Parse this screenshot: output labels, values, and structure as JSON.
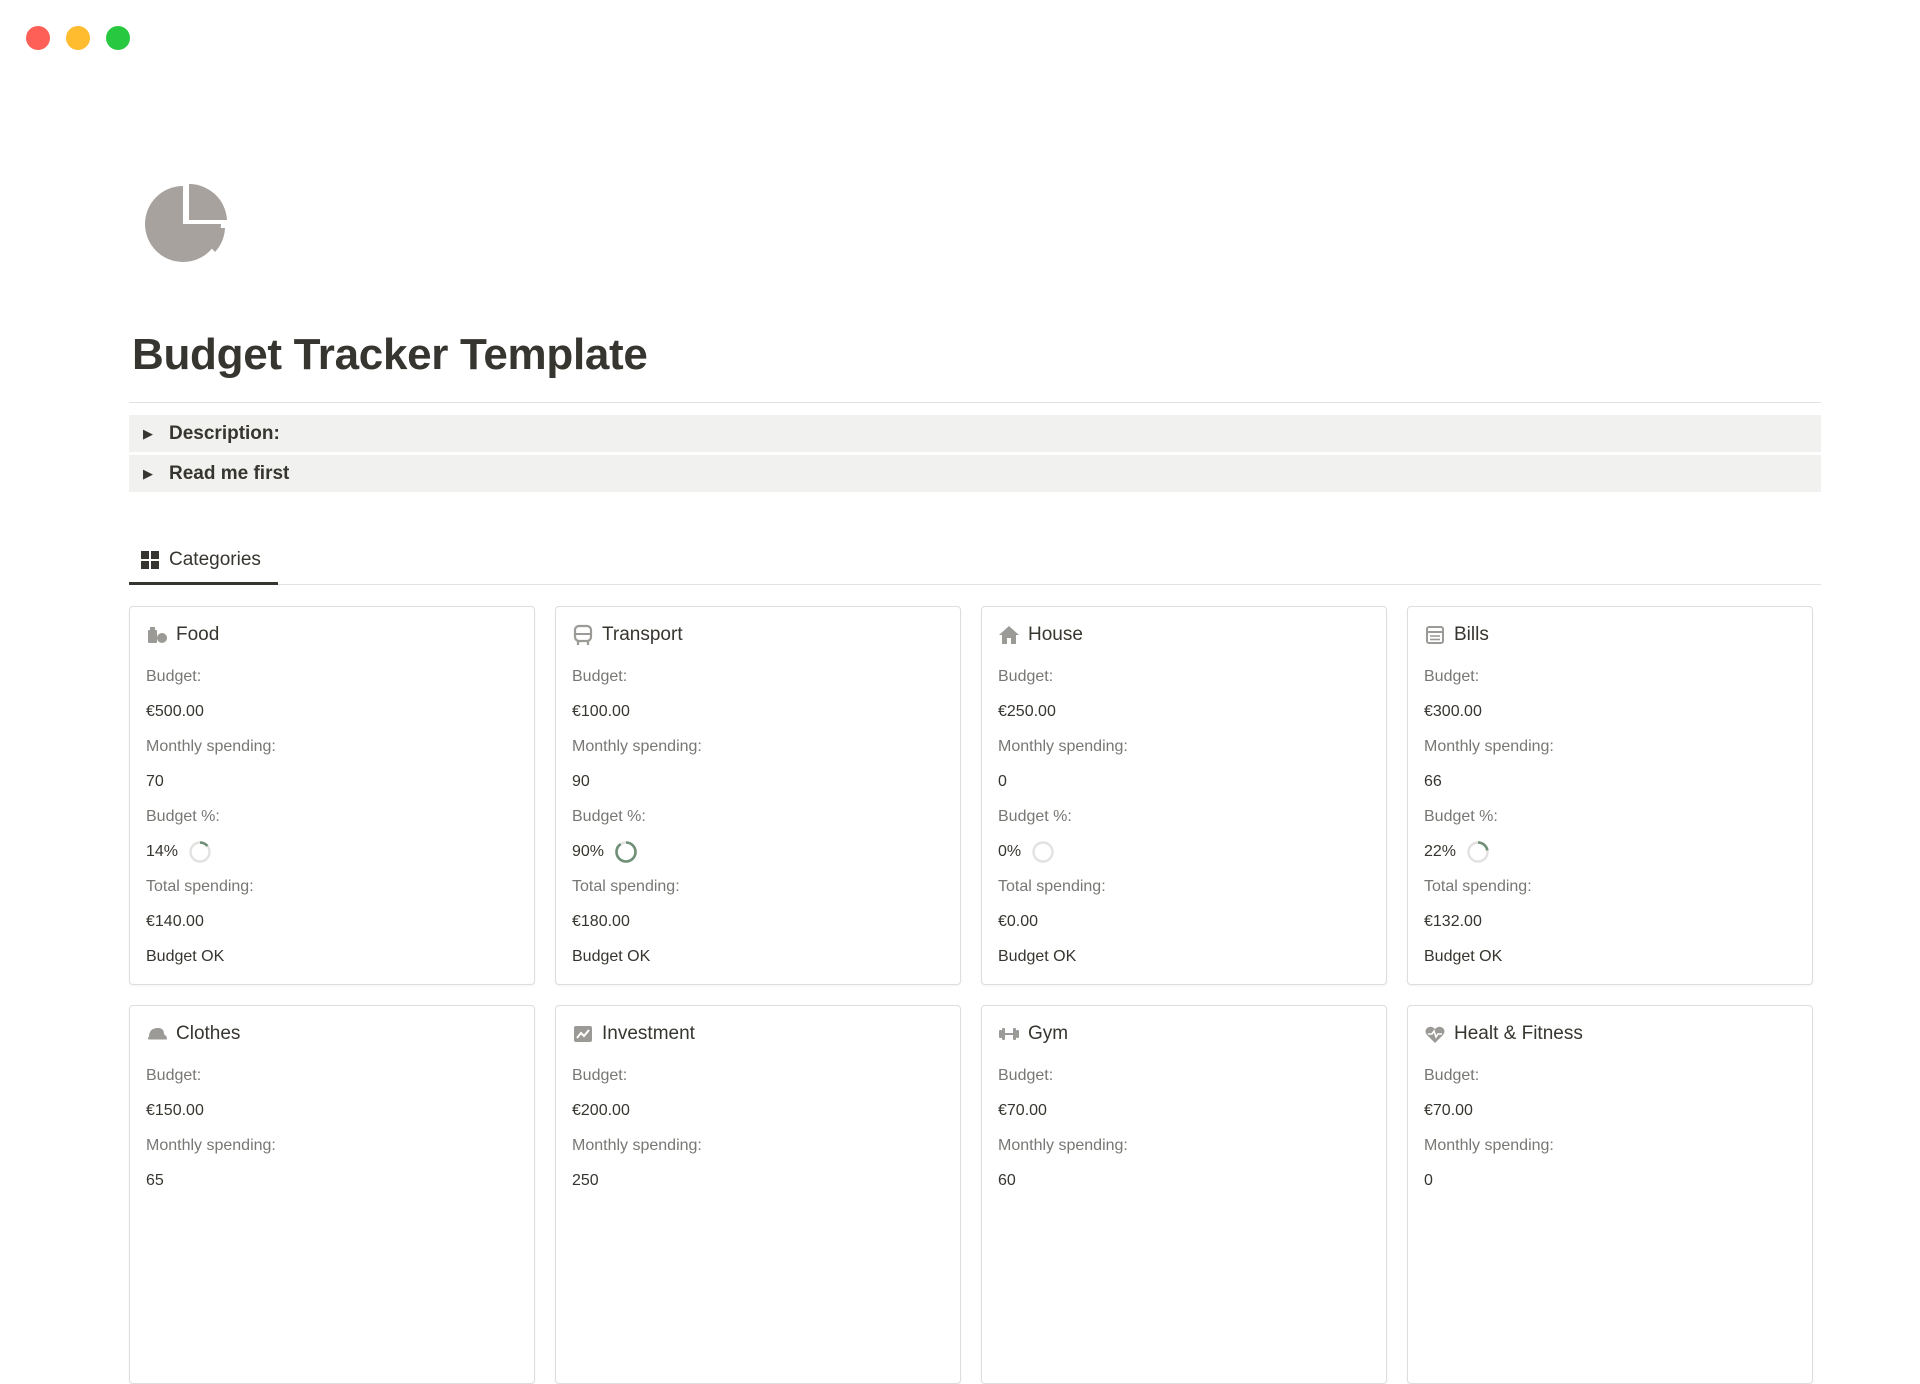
{
  "window": {
    "controls": [
      "close",
      "minimize",
      "maximize"
    ]
  },
  "page": {
    "title": "Budget Tracker Template",
    "icon": "pie-chart-icon",
    "colors": {
      "icon": "#a8a29e",
      "ring_progress": "#6f8f76",
      "ring_track": "#e3e2e0"
    }
  },
  "toggles": [
    {
      "label": "Description:"
    },
    {
      "label": "Read me first"
    }
  ],
  "view_tab": {
    "label": "Categories",
    "icon": "gallery-grid-icon"
  },
  "labels": {
    "budget": "Budget:",
    "monthly": "Monthly spending:",
    "percent": "Budget %:",
    "total": "Total spending:"
  },
  "cards": [
    {
      "title": "Food",
      "icon": "grocery-icon",
      "budget": "€500.00",
      "monthly": "70",
      "percent_text": "14%",
      "percent": 14,
      "total": "€140.00",
      "status": "Budget OK"
    },
    {
      "title": "Transport",
      "icon": "bus-icon",
      "budget": "€100.00",
      "monthly": "90",
      "percent_text": "90%",
      "percent": 90,
      "total": "€180.00",
      "status": "Budget OK"
    },
    {
      "title": "House",
      "icon": "house-icon",
      "budget": "€250.00",
      "monthly": "0",
      "percent_text": "0%",
      "percent": 0,
      "total": "€0.00",
      "status": "Budget OK"
    },
    {
      "title": "Bills",
      "icon": "receipt-icon",
      "budget": "€300.00",
      "monthly": "66",
      "percent_text": "22%",
      "percent": 22,
      "total": "€132.00",
      "status": "Budget OK"
    },
    {
      "title": "Clothes",
      "icon": "cap-icon",
      "budget": "€150.00",
      "monthly": "65"
    },
    {
      "title": "Investment",
      "icon": "chart-trend-icon",
      "budget": "€200.00",
      "monthly": "250"
    },
    {
      "title": "Gym",
      "icon": "dumbbell-icon",
      "budget": "€70.00",
      "monthly": "60"
    },
    {
      "title": "Healt & Fitness",
      "icon": "heart-pulse-icon",
      "budget": "€70.00",
      "monthly": "0"
    }
  ]
}
